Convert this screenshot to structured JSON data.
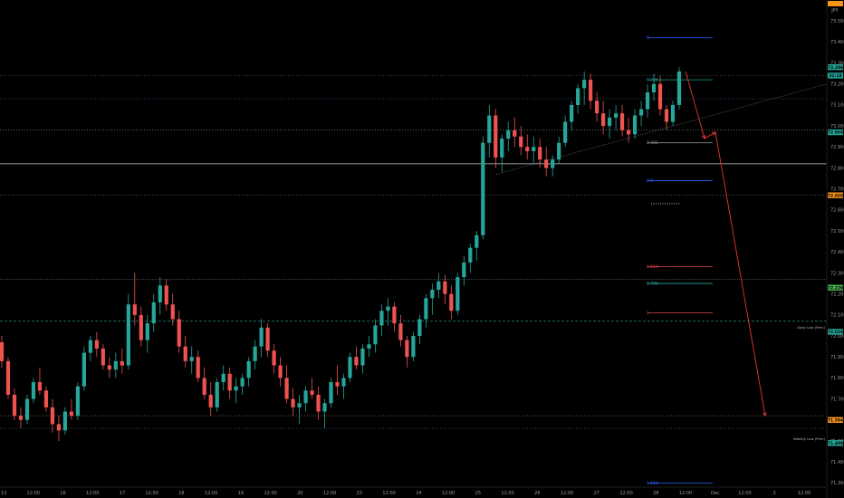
{
  "header": {
    "currency": "JPY"
  },
  "chart_data": {
    "type": "candlestick",
    "ylim": [
      71.28,
      73.6
    ],
    "y_ticks": [
      71.3,
      71.4,
      71.5,
      71.6,
      71.7,
      71.8,
      71.9,
      72.0,
      72.1,
      72.2,
      72.3,
      72.4,
      72.5,
      72.6,
      72.7,
      72.8,
      72.9,
      73.0,
      73.1,
      73.2,
      73.3,
      73.4,
      73.5
    ],
    "y_tick_labels": [
      "71.300",
      "71.400",
      "71.500",
      "71.600",
      "71.700",
      "71.800",
      "71.900",
      "72.000",
      "72.100",
      "72.200",
      "72.300",
      "72.400",
      "72.500",
      "72.600",
      "72.700",
      "72.800",
      "72.900",
      "73.000",
      "73.100",
      "73.200",
      "73.300",
      "73.400",
      "73.500"
    ],
    "x_axis_labels": [
      "13",
      "12:00",
      "16",
      "12:00",
      "17",
      "12:00",
      "18",
      "12:00",
      "19",
      "12:00",
      "20",
      "12:00",
      "23",
      "12:00",
      "24",
      "12:00",
      "25",
      "12:00",
      "26",
      "12:00",
      "27",
      "12:00",
      "28",
      "12:00",
      "Dec",
      "12:00",
      "2",
      "12:00"
    ],
    "candles_ohlc": [
      [
        71.97,
        72.0,
        71.85,
        71.88
      ],
      [
        71.88,
        71.9,
        71.7,
        71.72
      ],
      [
        71.72,
        71.75,
        71.6,
        71.62
      ],
      [
        71.62,
        71.66,
        71.56,
        71.6
      ],
      [
        71.6,
        71.72,
        71.58,
        71.7
      ],
      [
        71.7,
        71.8,
        71.68,
        71.78
      ],
      [
        71.78,
        71.85,
        71.72,
        71.74
      ],
      [
        71.74,
        71.76,
        71.64,
        71.66
      ],
      [
        71.66,
        71.7,
        71.54,
        71.58
      ],
      [
        71.58,
        71.62,
        71.5,
        71.55
      ],
      [
        71.55,
        71.66,
        71.53,
        71.64
      ],
      [
        71.64,
        71.7,
        71.6,
        71.62
      ],
      [
        71.62,
        71.78,
        71.6,
        71.76
      ],
      [
        71.76,
        71.95,
        71.74,
        71.92
      ],
      [
        71.92,
        72.0,
        71.88,
        71.98
      ],
      [
        71.98,
        72.02,
        71.9,
        71.94
      ],
      [
        71.94,
        71.96,
        71.84,
        71.86
      ],
      [
        71.86,
        71.9,
        71.8,
        71.84
      ],
      [
        71.84,
        71.92,
        71.8,
        71.88
      ],
      [
        71.88,
        71.94,
        71.82,
        71.86
      ],
      [
        71.86,
        72.2,
        71.84,
        72.15
      ],
      [
        72.15,
        72.3,
        72.05,
        72.1
      ],
      [
        72.1,
        72.14,
        71.95,
        71.98
      ],
      [
        71.98,
        72.1,
        71.92,
        72.06
      ],
      [
        72.06,
        72.2,
        72.02,
        72.16
      ],
      [
        72.16,
        72.28,
        72.1,
        72.24
      ],
      [
        72.24,
        72.27,
        72.12,
        72.15
      ],
      [
        72.15,
        72.2,
        72.05,
        72.08
      ],
      [
        72.08,
        72.12,
        71.92,
        71.95
      ],
      [
        71.95,
        72.0,
        71.85,
        71.88
      ],
      [
        71.88,
        71.95,
        71.82,
        71.9
      ],
      [
        71.9,
        71.93,
        71.78,
        71.8
      ],
      [
        71.8,
        71.85,
        71.7,
        71.72
      ],
      [
        71.72,
        71.78,
        71.62,
        71.66
      ],
      [
        71.66,
        71.8,
        71.64,
        71.78
      ],
      [
        71.78,
        71.86,
        71.74,
        71.82
      ],
      [
        71.82,
        71.85,
        71.7,
        71.74
      ],
      [
        71.74,
        71.8,
        71.68,
        71.76
      ],
      [
        71.76,
        71.82,
        71.72,
        71.8
      ],
      [
        71.8,
        71.9,
        71.76,
        71.88
      ],
      [
        71.88,
        71.98,
        71.84,
        71.95
      ],
      [
        71.95,
        72.08,
        71.9,
        72.04
      ],
      [
        72.04,
        72.06,
        71.9,
        71.93
      ],
      [
        71.93,
        71.96,
        71.82,
        71.86
      ],
      [
        71.86,
        71.9,
        71.76,
        71.8
      ],
      [
        71.8,
        71.86,
        71.68,
        71.7
      ],
      [
        71.7,
        71.75,
        71.62,
        71.66
      ],
      [
        71.66,
        71.72,
        71.58,
        71.68
      ],
      [
        71.68,
        71.76,
        71.64,
        71.74
      ],
      [
        71.74,
        71.8,
        71.7,
        71.72
      ],
      [
        71.72,
        71.76,
        71.6,
        71.64
      ],
      [
        71.64,
        71.7,
        71.56,
        71.68
      ],
      [
        71.68,
        71.8,
        71.66,
        71.78
      ],
      [
        71.78,
        71.86,
        71.72,
        71.76
      ],
      [
        71.76,
        71.82,
        71.7,
        71.8
      ],
      [
        71.8,
        71.92,
        71.78,
        71.9
      ],
      [
        71.9,
        71.95,
        71.84,
        71.86
      ],
      [
        71.86,
        71.96,
        71.82,
        71.94
      ],
      [
        71.94,
        72.0,
        71.9,
        71.96
      ],
      [
        71.96,
        72.08,
        71.92,
        72.05
      ],
      [
        72.05,
        72.15,
        72.0,
        72.12
      ],
      [
        72.12,
        72.18,
        72.05,
        72.14
      ],
      [
        72.14,
        72.16,
        72.02,
        72.06
      ],
      [
        72.06,
        72.1,
        71.95,
        71.98
      ],
      [
        71.98,
        72.0,
        71.85,
        71.9
      ],
      [
        71.9,
        72.02,
        71.88,
        72.0
      ],
      [
        72.0,
        72.1,
        71.96,
        72.08
      ],
      [
        72.08,
        72.2,
        72.04,
        72.18
      ],
      [
        72.18,
        72.25,
        72.1,
        72.22
      ],
      [
        72.22,
        72.3,
        72.18,
        72.26
      ],
      [
        72.26,
        72.29,
        72.15,
        72.2
      ],
      [
        72.2,
        72.24,
        72.08,
        72.12
      ],
      [
        72.12,
        72.3,
        72.1,
        72.28
      ],
      [
        72.28,
        72.38,
        72.24,
        72.35
      ],
      [
        72.35,
        72.44,
        72.3,
        72.42
      ],
      [
        72.42,
        72.5,
        72.36,
        72.48
      ],
      [
        72.48,
        72.95,
        72.46,
        72.92
      ],
      [
        72.92,
        73.1,
        72.85,
        73.05
      ],
      [
        73.05,
        73.08,
        72.8,
        72.85
      ],
      [
        72.85,
        72.96,
        72.78,
        72.94
      ],
      [
        72.94,
        73.02,
        72.88,
        72.98
      ],
      [
        72.98,
        73.04,
        72.9,
        72.95
      ],
      [
        72.95,
        73.0,
        72.86,
        72.9
      ],
      [
        72.9,
        72.96,
        72.84,
        72.88
      ],
      [
        72.88,
        72.95,
        72.82,
        72.9
      ],
      [
        72.9,
        72.94,
        72.8,
        72.84
      ],
      [
        72.84,
        72.9,
        72.76,
        72.8
      ],
      [
        72.8,
        72.86,
        72.76,
        72.84
      ],
      [
        72.84,
        72.95,
        72.82,
        72.92
      ],
      [
        72.92,
        73.05,
        72.9,
        73.02
      ],
      [
        73.02,
        73.12,
        72.98,
        73.1
      ],
      [
        73.1,
        73.2,
        73.06,
        73.18
      ],
      [
        73.18,
        73.26,
        73.1,
        73.22
      ],
      [
        73.22,
        73.25,
        73.08,
        73.12
      ],
      [
        73.12,
        73.16,
        73.02,
        73.06
      ],
      [
        73.06,
        73.12,
        72.96,
        73.0
      ],
      [
        73.0,
        73.08,
        72.94,
        73.04
      ],
      [
        73.04,
        73.1,
        72.98,
        73.06
      ],
      [
        73.06,
        73.1,
        72.95,
        72.98
      ],
      [
        72.98,
        73.04,
        72.92,
        72.96
      ],
      [
        72.96,
        73.08,
        72.94,
        73.05
      ],
      [
        73.05,
        73.12,
        73.0,
        73.08
      ],
      [
        73.08,
        73.2,
        73.04,
        73.16
      ],
      [
        73.16,
        73.25,
        73.12,
        73.2
      ],
      [
        73.2,
        73.24,
        73.05,
        73.08
      ],
      [
        73.08,
        73.1,
        72.98,
        73.02
      ],
      [
        73.02,
        73.12,
        73.0,
        73.1
      ],
      [
        73.1,
        73.28,
        73.08,
        73.26
      ]
    ]
  },
  "price_lines": [
    {
      "price": 73.24,
      "color": "#555555",
      "dash": "1,2"
    },
    {
      "price": 73.13,
      "color": "#3b5998",
      "dash": "1,2"
    },
    {
      "price": 72.98,
      "color": "#888888",
      "dash": "1,2"
    },
    {
      "price": 72.82,
      "color": "#cfcfcf",
      "dash": ""
    },
    {
      "price": 72.67,
      "color": "#777777",
      "dash": "1,2"
    },
    {
      "price": 72.27,
      "color": "#5f6f80",
      "dash": "1,1"
    },
    {
      "price": 72.07,
      "color": "#26a69a",
      "dash": "3,2"
    },
    {
      "price": 71.62,
      "color": "#8f7a4a",
      "dash": "1,2"
    },
    {
      "price": 71.56,
      "color": "#3b7aa0",
      "dash": "1,2"
    }
  ],
  "fib_levels": [
    {
      "label": "0",
      "price": 73.42,
      "color": "#2962ff"
    },
    {
      "label": "0.236",
      "price": 73.22,
      "color": "#26a69a"
    },
    {
      "label": "0.382",
      "price": 72.92,
      "color": "#888888"
    },
    {
      "label": "0.5",
      "price": 72.74,
      "color": "#2962ff"
    },
    {
      "label": "0.618",
      "price": 72.33,
      "color": "#e0484b"
    },
    {
      "label": "0.786",
      "price": 72.25,
      "color": "#26a69a"
    },
    {
      "label": "1",
      "price": 72.11,
      "color": "#e0484b"
    },
    {
      "label": "1.618",
      "price": 71.3,
      "color": "#2962ff"
    }
  ],
  "right_badges": [
    {
      "text": "73.286",
      "price": 73.28,
      "bg": "#26a69a",
      "fg": "#000000"
    },
    {
      "text": "32:18",
      "price": 73.24,
      "bg": "#26a69a",
      "fg": "#000000"
    },
    {
      "text": "72.966",
      "price": 72.97,
      "bg": "#26a69a",
      "fg": "#000000"
    },
    {
      "text": "72.668",
      "price": 72.67,
      "bg": "#f7931a",
      "fg": "#000000"
    },
    {
      "text": "72.229",
      "price": 72.23,
      "bg": "#4caf50",
      "fg": "#000000"
    },
    {
      "text": "72.026",
      "price": 72.02,
      "bg": "#26a69a",
      "fg": "#000000"
    },
    {
      "text": "71.594",
      "price": 71.6,
      "bg": "#f7931a",
      "fg": "#000000"
    },
    {
      "text": "71.488",
      "price": 71.49,
      "bg": "#26a69a",
      "fg": "#000000"
    }
  ],
  "right_side_labels": [
    {
      "text": "Daily Low (Prev)",
      "price": 72.03
    },
    {
      "text": "Weekly Low (Prev)",
      "price": 71.5
    }
  ],
  "colors": {
    "up": "#26a69a",
    "down": "#ef5350",
    "projection": "#e53935",
    "trendline": "#888888"
  }
}
